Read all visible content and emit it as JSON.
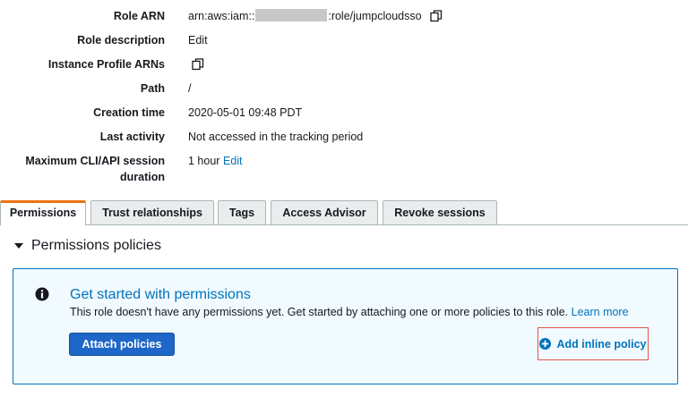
{
  "summary": {
    "role_arn": {
      "label": "Role ARN",
      "prefix": "arn:aws:iam::",
      "suffix": ":role/jumpcloudsso"
    },
    "role_description": {
      "label": "Role description",
      "edit": "Edit"
    },
    "instance_profile_arns": {
      "label": "Instance Profile ARNs"
    },
    "path": {
      "label": "Path",
      "value": "/"
    },
    "creation_time": {
      "label": "Creation time",
      "value": "2020-05-01 09:48 PDT"
    },
    "last_activity": {
      "label": "Last activity",
      "value": "Not accessed in the tracking period"
    },
    "max_session": {
      "label_line1": "Maximum CLI/API session",
      "label_line2": "duration",
      "value": "1 hour",
      "edit": "Edit"
    }
  },
  "tabs": [
    {
      "label": "Permissions",
      "active": true
    },
    {
      "label": "Trust relationships",
      "active": false
    },
    {
      "label": "Tags",
      "active": false
    },
    {
      "label": "Access Advisor",
      "active": false
    },
    {
      "label": "Revoke sessions",
      "active": false
    }
  ],
  "permissions": {
    "section_title": "Permissions policies",
    "panel": {
      "title": "Get started with permissions",
      "text": "This role doesn't have any permissions yet. Get started by attaching one or more policies to this role.",
      "learn_more": "Learn more",
      "attach_button": "Attach policies",
      "inline_button": "Add inline policy"
    }
  },
  "icons": {
    "copy": "copy-icon",
    "info": "info-icon",
    "plus": "plus-circle-icon",
    "caret": "caret-down-icon"
  },
  "colors": {
    "link": "#0073bb",
    "tab_active_accent": "#ec7211",
    "primary_button": "#1e67c8",
    "panel_bg": "#f1faff",
    "highlight_border": "#e0574c"
  }
}
